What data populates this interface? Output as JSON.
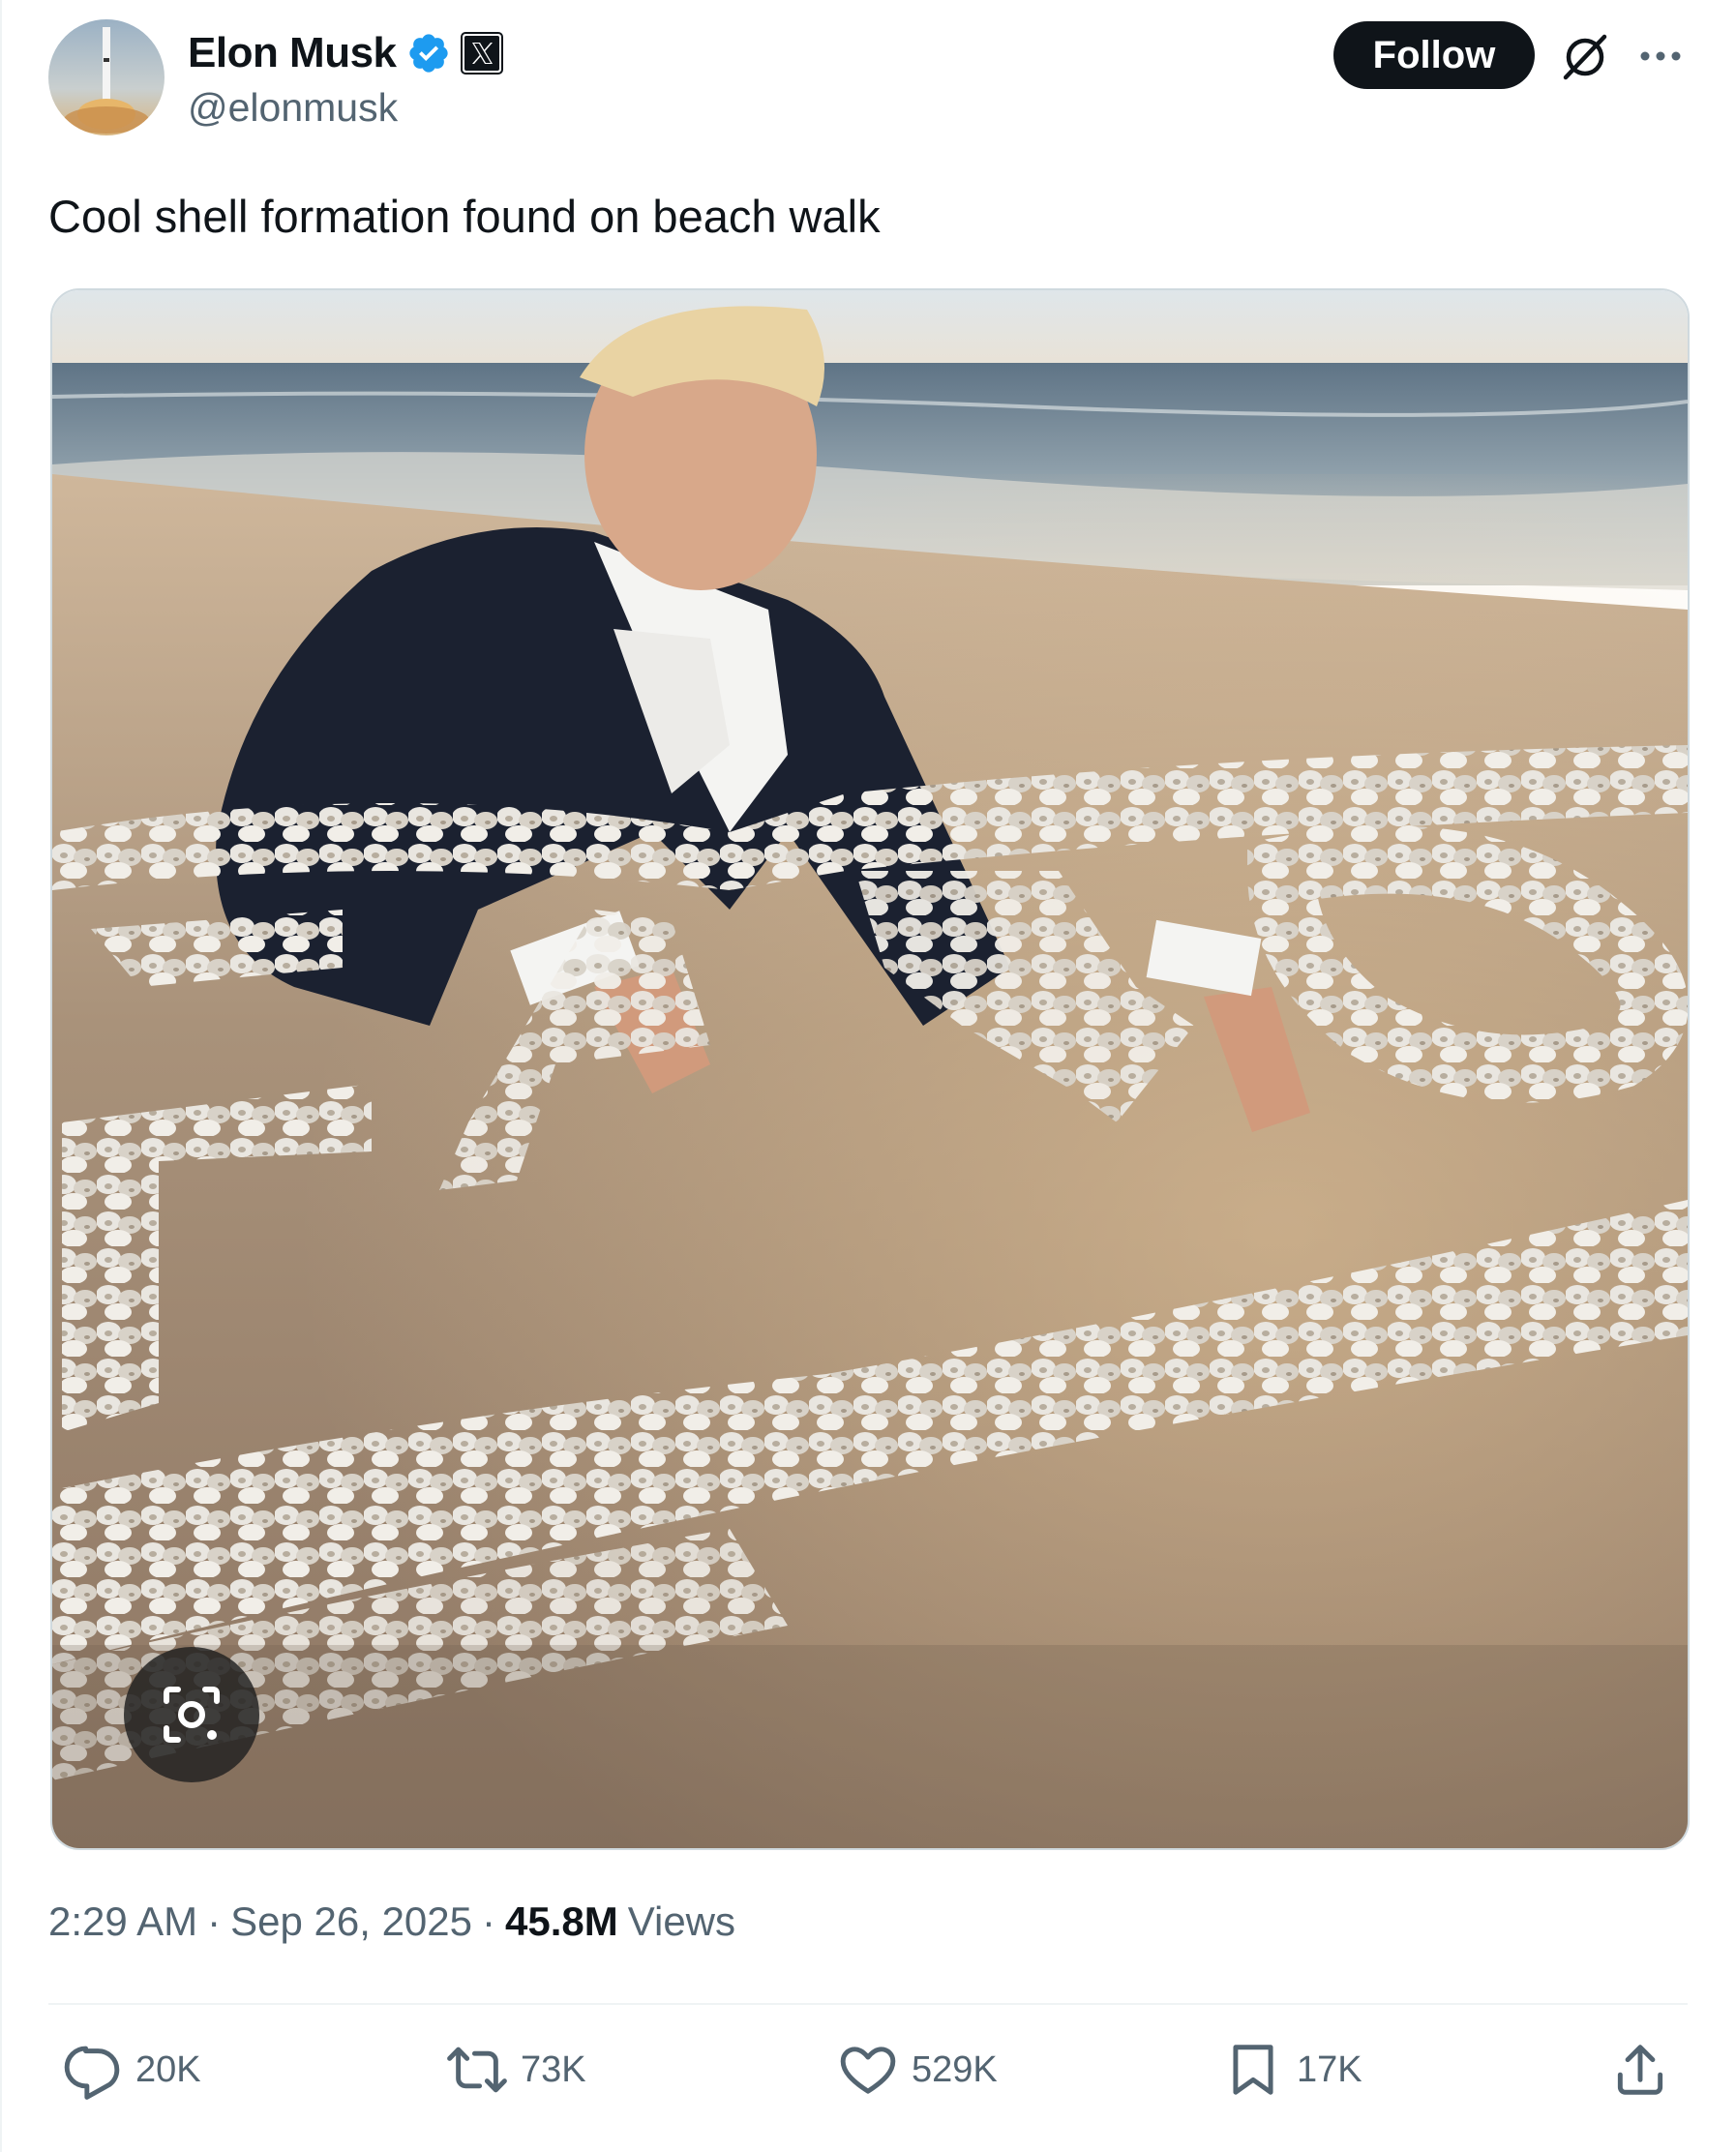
{
  "author": {
    "name": "Elon Musk",
    "handle": "@elonmusk",
    "verified": true,
    "affiliation_badge": "X"
  },
  "header": {
    "follow_label": "Follow",
    "grok_icon": "grok-icon",
    "more_icon": "more-icon"
  },
  "tweet": {
    "text": "Cool shell formation found on beach walk"
  },
  "media": {
    "kind": "photo",
    "lens_icon": "visual-search-icon"
  },
  "meta": {
    "time": "2:29 AM",
    "separator": "·",
    "date": "Sep 26, 2025",
    "views_count": "45.8M",
    "views_label": "Views"
  },
  "actions": {
    "reply_count": "20K",
    "repost_count": "73K",
    "like_count": "529K",
    "bookmark_count": "17K"
  },
  "colors": {
    "text": "#0f1419",
    "secondary": "#536471",
    "verified_blue": "#1d9bf0",
    "follow_bg": "#0f1419"
  }
}
